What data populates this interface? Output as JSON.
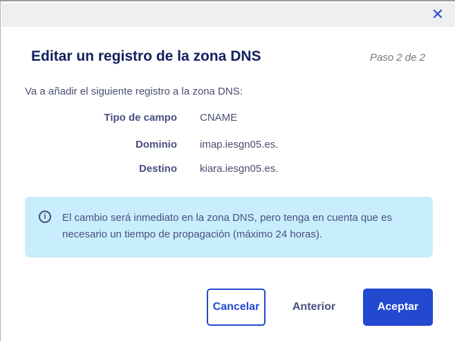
{
  "dialog": {
    "close_icon": "close-icon",
    "title": "Editar un registro de la zona DNS",
    "step": "Paso 2 de 2",
    "intro": "Va a añadir el siguiente registro a la zona DNS:",
    "fields": [
      {
        "label": "Tipo de campo",
        "value": "CNAME"
      },
      {
        "label": "Dominio",
        "value": "imap.iesgn05.es."
      },
      {
        "label": "Destino",
        "value": "kiara.iesgn05.es."
      }
    ],
    "info_icon": "info-icon",
    "info": "El cambio será inmediato en la zona DNS, pero tenga en cuenta que es necesario un tiempo de propagación (máximo 24 horas).",
    "buttons": {
      "cancel": "Cancelar",
      "previous": "Anterior",
      "accept": "Aceptar"
    },
    "colors": {
      "accent": "#2249d0",
      "title": "#122060",
      "info_bg": "#c8eefd"
    }
  }
}
